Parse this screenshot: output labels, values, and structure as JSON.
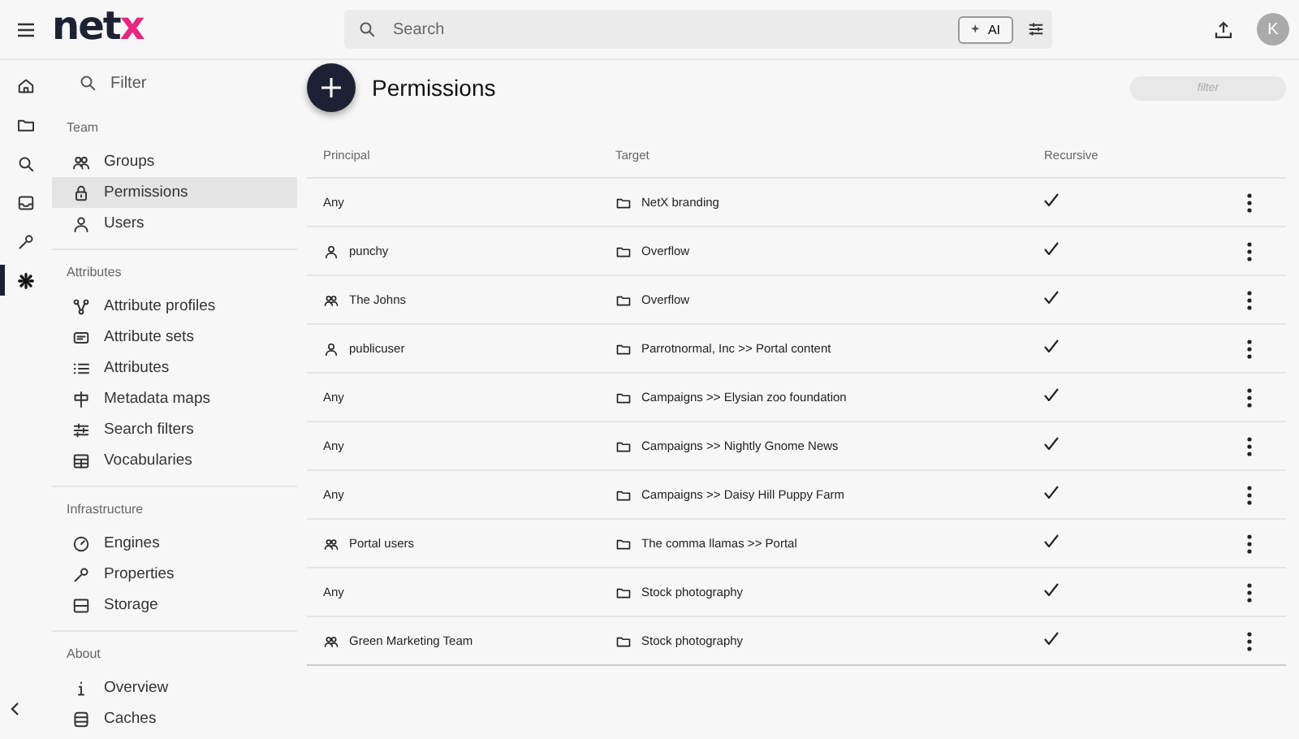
{
  "topbar": {
    "logo": "netx",
    "search": {
      "placeholder": "Search"
    },
    "ai_button": "AI",
    "avatar": "K"
  },
  "rail": [
    {
      "selected": false
    },
    {
      "selected": false
    },
    {
      "selected": false
    },
    {
      "selected": false
    },
    {
      "selected": false
    },
    {
      "selected": true
    }
  ],
  "sidebar": {
    "filter": {
      "placeholder": "Filter"
    },
    "sections": [
      {
        "title": "Team",
        "items": [
          {
            "label": "Groups",
            "selected": false
          },
          {
            "label": "Permissions",
            "selected": true
          },
          {
            "label": "Users",
            "selected": false
          }
        ]
      },
      {
        "title": "Attributes",
        "items": [
          {
            "label": "Attribute profiles",
            "selected": false
          },
          {
            "label": "Attribute sets",
            "selected": false
          },
          {
            "label": "Attributes",
            "selected": false
          },
          {
            "label": "Metadata maps",
            "selected": false
          },
          {
            "label": "Search filters",
            "selected": false
          },
          {
            "label": "Vocabularies",
            "selected": false
          }
        ]
      },
      {
        "title": "Infrastructure",
        "items": [
          {
            "label": "Engines",
            "selected": false
          },
          {
            "label": "Properties",
            "selected": false
          },
          {
            "label": "Storage",
            "selected": false
          }
        ]
      },
      {
        "title": "About",
        "items": [
          {
            "label": "Overview",
            "selected": false
          },
          {
            "label": "Caches",
            "selected": false
          }
        ]
      }
    ]
  },
  "main": {
    "title": "Permissions",
    "filter": {
      "placeholder": "filter"
    },
    "table": {
      "columns": [
        "Principal",
        "Target",
        "Recursive"
      ],
      "rows": [
        {
          "principal": "Any",
          "kind": "any",
          "target": "NetX branding",
          "recursive": true
        },
        {
          "principal": "punchy",
          "kind": "user",
          "target": "Overflow",
          "recursive": true
        },
        {
          "principal": "The Johns",
          "kind": "group",
          "target": "Overflow",
          "recursive": true
        },
        {
          "principal": "publicuser",
          "kind": "user",
          "target": "Parrotnormal, Inc >> Portal content",
          "recursive": true
        },
        {
          "principal": "Any",
          "kind": "any",
          "target": "Campaigns >> Elysian zoo foundation",
          "recursive": true
        },
        {
          "principal": "Any",
          "kind": "any",
          "target": "Campaigns >> Nightly Gnome News",
          "recursive": true
        },
        {
          "principal": "Any",
          "kind": "any",
          "target": "Campaigns >> Daisy Hill Puppy Farm",
          "recursive": true
        },
        {
          "principal": "Portal users",
          "kind": "group",
          "target": "The comma llamas >> Portal",
          "recursive": true
        },
        {
          "principal": "Any",
          "kind": "any",
          "target": "Stock photography",
          "recursive": true
        },
        {
          "principal": "Green Marketing Team",
          "kind": "group",
          "target": "Stock photography",
          "recursive": true
        }
      ]
    }
  }
}
